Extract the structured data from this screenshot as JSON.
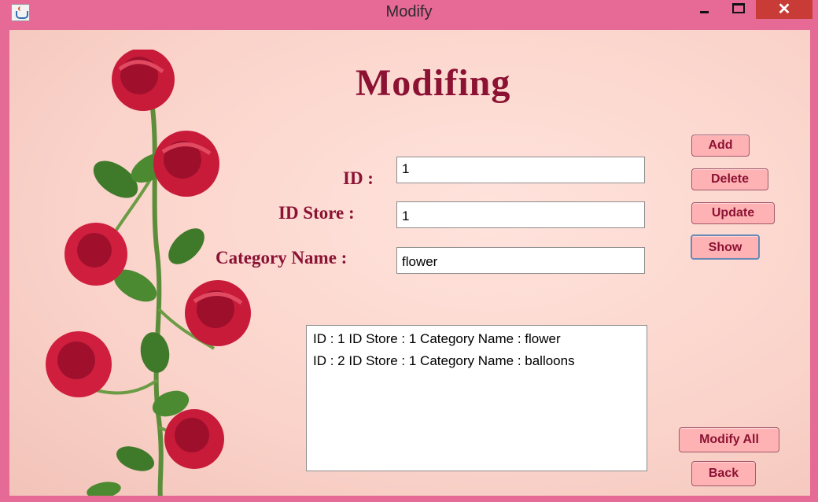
{
  "window": {
    "title": "Modify",
    "close_label": "✕"
  },
  "heading": "Modifing",
  "form": {
    "id_label": "ID :",
    "id_value": "1",
    "store_label": "ID Store :",
    "store_value": "1",
    "category_label": "Category Name :",
    "category_value": "flower"
  },
  "buttons": {
    "add": "Add",
    "delete": "Delete",
    "update": "Update",
    "show": "Show",
    "modify_all": "Modify All",
    "back": "Back"
  },
  "results": [
    "ID : 1  ID Store : 1  Category Name : flower",
    "ID : 2  ID Store : 1  Category Name : balloons"
  ],
  "colors": {
    "frame": "#e56b96",
    "heading": "#8b1233",
    "button_bg": "#ffb2b4",
    "close_bg": "#c83b36"
  }
}
